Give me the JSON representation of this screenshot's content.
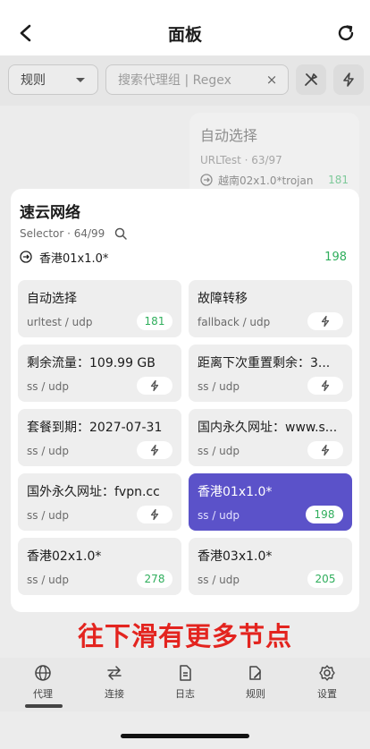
{
  "header": {
    "title": "面板"
  },
  "filter": {
    "rule_select": "规则",
    "search_placeholder": "搜索代理组 | Regex",
    "clear": "×"
  },
  "background_group": {
    "name": "自动选择",
    "meta": "URLTest · 63/97",
    "current": "越南02x1.0*trojan",
    "delay": "181"
  },
  "group": {
    "name": "速云网络",
    "meta": "Selector · 64/99",
    "current": "香港01x1.0*",
    "current_delay": "198",
    "nodes": [
      {
        "name": "自动选择",
        "proto": "urltest / udp",
        "delay": "181",
        "selected": false
      },
      {
        "name": "故障转移",
        "proto": "fallback / udp",
        "delay": "",
        "selected": false
      },
      {
        "name": "剩余流量：109.99 GB",
        "proto": "ss / udp",
        "delay": "",
        "selected": false
      },
      {
        "name": "距离下次重置剩余：3...",
        "proto": "ss / udp",
        "delay": "",
        "selected": false
      },
      {
        "name": "套餐到期：2027-07-31",
        "proto": "ss / udp",
        "delay": "",
        "selected": false
      },
      {
        "name": "国内永久网址：www.s...",
        "proto": "ss / udp",
        "delay": "",
        "selected": false
      },
      {
        "name": "国外永久网址：fvpn.cc",
        "proto": "ss / udp",
        "delay": "",
        "selected": false
      },
      {
        "name": "香港01x1.0*",
        "proto": "ss / udp",
        "delay": "198",
        "selected": true
      },
      {
        "name": "香港02x1.0*",
        "proto": "ss / udp",
        "delay": "278",
        "selected": false
      },
      {
        "name": "香港03x1.0*",
        "proto": "ss / udp",
        "delay": "205",
        "selected": false
      }
    ]
  },
  "overlay_text": "往下滑有更多节点",
  "bottom_nav": [
    {
      "label": "代理",
      "icon": "globe-icon",
      "active": true
    },
    {
      "label": "连接",
      "icon": "arrows-swap-icon",
      "active": false
    },
    {
      "label": "日志",
      "icon": "document-icon",
      "active": false
    },
    {
      "label": "规则",
      "icon": "rules-icon",
      "active": false
    },
    {
      "label": "设置",
      "icon": "gear-icon",
      "active": false
    }
  ],
  "colors": {
    "accent": "#5b52c9",
    "delay_green": "#2fae5c",
    "overlay_red": "#e3241f"
  }
}
